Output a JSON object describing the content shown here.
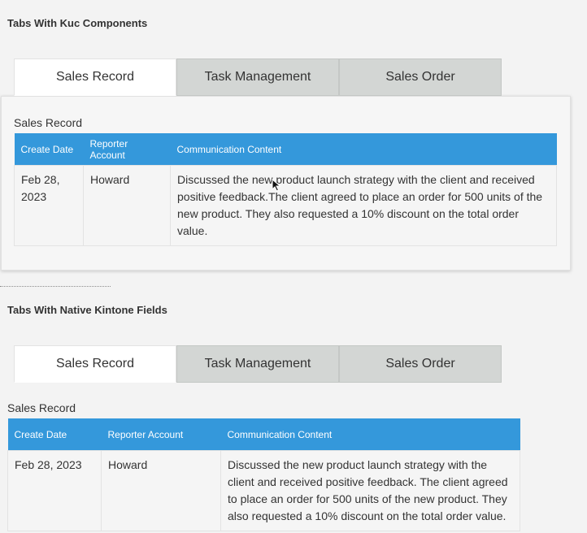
{
  "section1": {
    "title": "Tabs With Kuc Components",
    "tabs": [
      "Sales Record",
      "Task Management",
      "Sales Order"
    ],
    "panel_label": "Sales Record",
    "table": {
      "headers": [
        "Create Date",
        "Reporter Account",
        "Communication Content"
      ],
      "row": {
        "date": "Feb 28, 2023",
        "reporter": "Howard",
        "content": "Discussed the new product launch strategy with the client and received positive feedback.The client agreed to place an order for 500 units of the new product. They also requested a 10% discount on the total order value."
      }
    }
  },
  "section2": {
    "title": "Tabs With Native Kintone Fields",
    "tabs": [
      "Sales Record",
      "Task Management",
      "Sales Order"
    ],
    "panel_label": "Sales Record",
    "table": {
      "headers": [
        "Create Date",
        "Reporter Account",
        "Communication Content"
      ],
      "row": {
        "date": "Feb 28, 2023",
        "reporter": "Howard",
        "content": "Discussed the new product launch strategy with the client and received positive feedback. The client agreed to place an order for 500 units of the new product. They also requested a 10% discount on the total order value."
      }
    }
  },
  "colors": {
    "header_blue": "#3498db",
    "tab_inactive": "#d3d6d4"
  },
  "icons": {
    "cursor": "mouse-pointer-icon"
  }
}
